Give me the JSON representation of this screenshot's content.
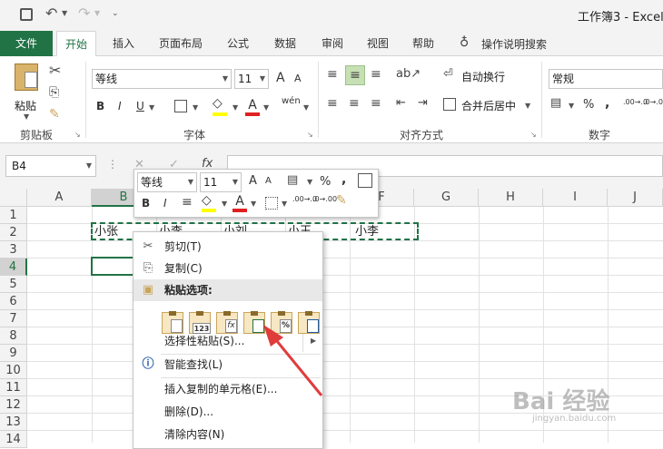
{
  "title": {
    "doc": "工作簿3",
    "sep": " - ",
    "app": "Excel"
  },
  "tabs": [
    "文件",
    "开始",
    "插入",
    "页面布局",
    "公式",
    "数据",
    "审阅",
    "视图",
    "帮助"
  ],
  "tellme": "操作说明搜索",
  "ribbon": {
    "paste": "粘贴",
    "clipboard": "剪贴板",
    "font_name": "等线",
    "font_size": "11",
    "font_group": "字体",
    "wrap": "自动换行",
    "merge": "合并后居中",
    "align_group": "对齐方式",
    "number_format": "常规",
    "number_group": "数字",
    "pct": "%",
    "comma": ",",
    "inc_dec": ".00→.0",
    "dec_dec": ".0→.00",
    "bold": "B",
    "italic": "I",
    "underline": "U",
    "grow_font": "A",
    "shrink_font": "A",
    "font_color": "A",
    "phonetic": "wén"
  },
  "formula_bar": {
    "name_box": "B4",
    "fx": "fx"
  },
  "columns": [
    "A",
    "B",
    "C",
    "D",
    "E",
    "F",
    "G",
    "H",
    "I",
    "J"
  ],
  "rows": [
    "1",
    "2",
    "3",
    "4",
    "5",
    "6",
    "7",
    "8",
    "9",
    "10",
    "11",
    "12",
    "13",
    "14"
  ],
  "cells": {
    "B2": "小张",
    "C2": "小李",
    "D2": "小刘",
    "E2": "小王",
    "F2": "小李"
  },
  "mini_toolbar": {
    "font_name": "等线",
    "font_size": "11",
    "bold": "B",
    "italic": "I",
    "pct": "%",
    "comma": ",",
    "grow": "A",
    "shrink": "A",
    "font_color": "A",
    "inc_dec": ".00→.0",
    "dec_dec": ".0→.00"
  },
  "context_menu": {
    "cut": "剪切(T)",
    "copy": "复制(C)",
    "paste_options": "粘贴选项:",
    "paste_special": "选择性粘贴(S)...",
    "smart_lookup": "智能查找(L)",
    "insert_copied": "插入复制的单元格(E)...",
    "delete": "删除(D)...",
    "clear": "清除内容(N)"
  },
  "paste_icons": [
    "",
    "123",
    "fx",
    "",
    "%",
    ""
  ],
  "watermark": {
    "brand": "Bai  经验",
    "url": "jingyan.baidu.com"
  },
  "colors": {
    "excel_green": "#217346",
    "selection": "#217346",
    "arrow": "#e03c3c"
  }
}
